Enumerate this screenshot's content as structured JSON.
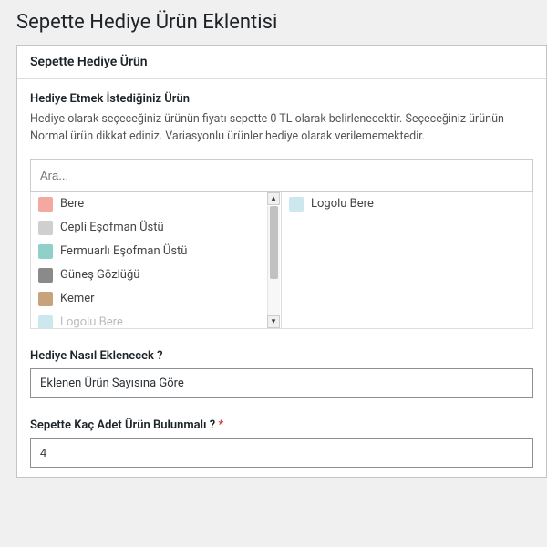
{
  "page_title": "Sepette Hediye Ürün Eklentisi",
  "panel": {
    "title": "Sepette Hediye Ürün"
  },
  "section1": {
    "label": "Hediye Etmek İstediğiniz Ürün",
    "desc": "Hediye olarak seçeceğiniz ürünün fiyatı sepette 0 TL olarak belirlenecektir. Seçeceğiniz ürünün Normal ürün dikkat ediniz. Variasyonlu ürünler hediye olarak verilememektedir.",
    "search_placeholder": "Ara..."
  },
  "available": [
    {
      "label": "Bere",
      "color": "#f4a9a0"
    },
    {
      "label": "Cepli Eşofman Üstü",
      "color": "#cfcfcf"
    },
    {
      "label": "Fermuarlı Eşofman Üstü",
      "color": "#8fd1c9"
    },
    {
      "label": "Güneş Gözlüğü",
      "color": "#8a8a8a"
    },
    {
      "label": "Kemer",
      "color": "#c7a27a"
    },
    {
      "label": "Logolu Bere",
      "color": "#cde7ef",
      "faded": true
    }
  ],
  "selected": [
    {
      "label": "Logolu Bere",
      "color": "#cde7ef"
    }
  ],
  "section2": {
    "label": "Hediye Nasıl Eklenecek ?",
    "value": "Eklenen Ürün Sayısına Göre"
  },
  "section3": {
    "label": "Sepette Kaç Adet Ürün Bulunmalı ?",
    "required": "*",
    "value": "4"
  }
}
